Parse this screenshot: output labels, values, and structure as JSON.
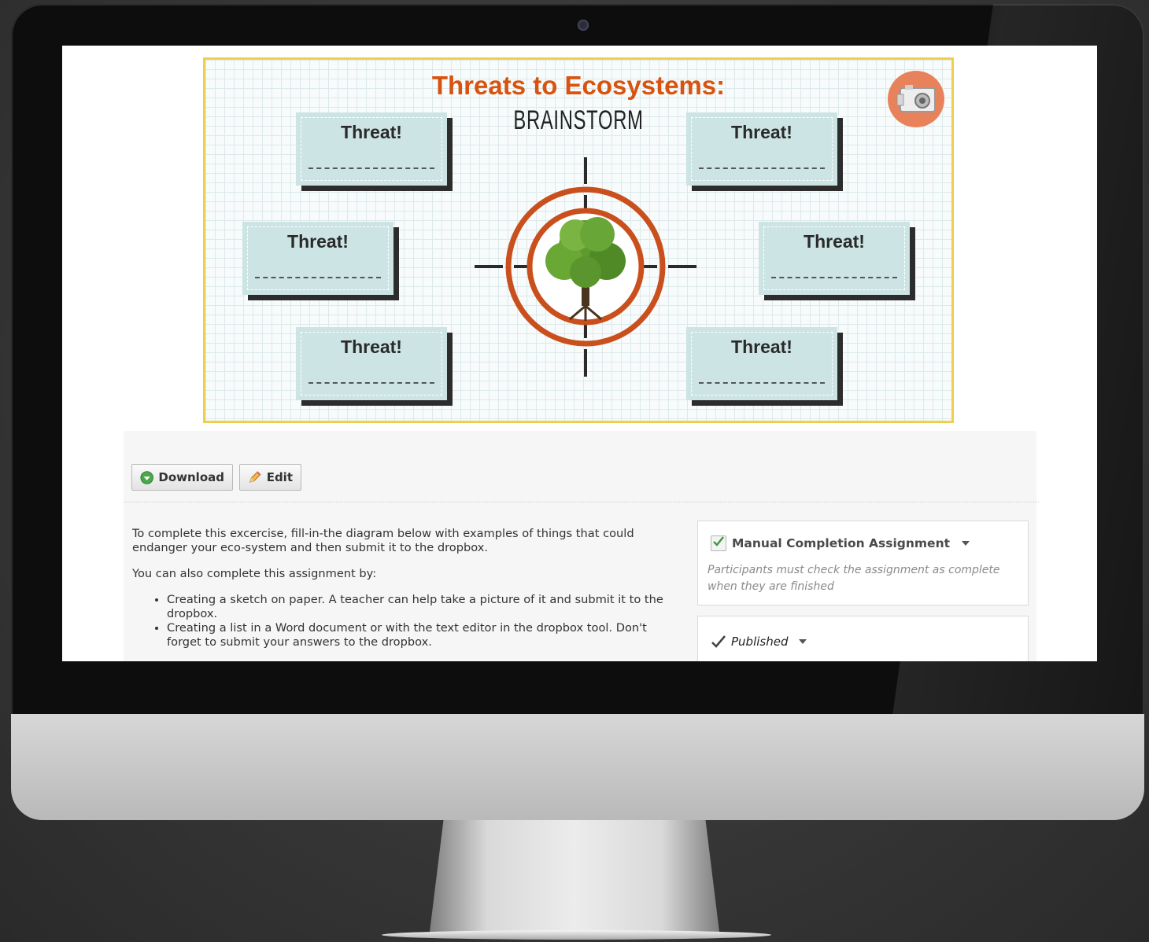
{
  "diagram": {
    "title": "Threats to Ecosystems:",
    "subtitle": "BRAINSTORM",
    "card_label": "Threat!",
    "colors": {
      "title": "#d9530f",
      "border": "#f0cf4c",
      "card": "#cde4e5",
      "target_ring": "#c9501c",
      "tree": "#5d9b2f"
    },
    "icons": {
      "badge": "camera-icon",
      "center": "tree-icon"
    }
  },
  "toolbar": {
    "download_label": "Download",
    "edit_label": "Edit"
  },
  "description": {
    "intro": "To complete this excercise, fill-in-the diagram below with examples of things that could endanger your eco-system and then submit it to the dropbox.",
    "also": "You can also complete this assignment by:",
    "options": [
      "Creating a sketch on paper. A teacher can help take a picture of it and submit it to the dropbox.",
      "Creating a list in a Word document or with the text editor in the dropbox tool. Don't forget to submit your answers to the dropbox."
    ]
  },
  "completion_panel": {
    "heading": "Manual Completion Assignment",
    "checked": true,
    "help": "Participants must check the assignment as complete when they are finished"
  },
  "publish_panel": {
    "status": "Published"
  }
}
